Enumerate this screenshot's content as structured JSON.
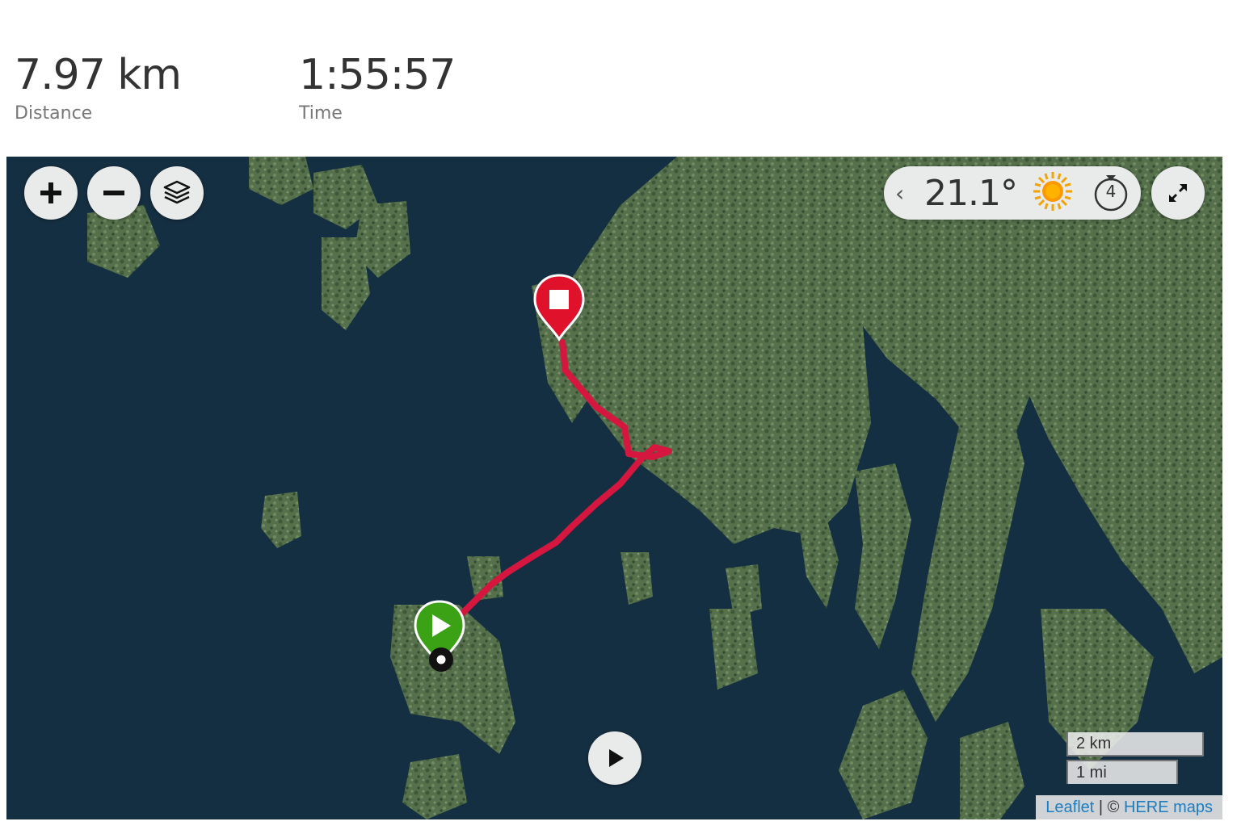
{
  "stats": {
    "distance": {
      "value": "7.97 km",
      "label": "Distance"
    },
    "time": {
      "value": "1:55:57",
      "label": "Time"
    }
  },
  "map": {
    "controls": {
      "zoom_in_icon": "plus-icon",
      "zoom_out_icon": "minus-icon",
      "layers_icon": "layers-icon",
      "fullscreen_icon": "expand-icon",
      "replay_icon": "play-icon"
    },
    "weather": {
      "chevron": "‹",
      "temperature": "21.1°",
      "condition_icon": "sun-icon",
      "timer_value": "4"
    },
    "scale": {
      "metric": "2 km",
      "imperial": "1 mi"
    },
    "attribution": {
      "leaflet": "Leaflet",
      "separator": " | © ",
      "provider": "HERE maps"
    },
    "markers": {
      "start_icon": "play-marker-icon",
      "finish_icon": "stop-marker-icon",
      "current_icon": "position-dot-icon"
    },
    "colors": {
      "route": "#d5173f",
      "start_marker": "#3aa214",
      "finish_marker": "#e0112b",
      "water": "#152f42",
      "land": "#4e6544"
    }
  }
}
